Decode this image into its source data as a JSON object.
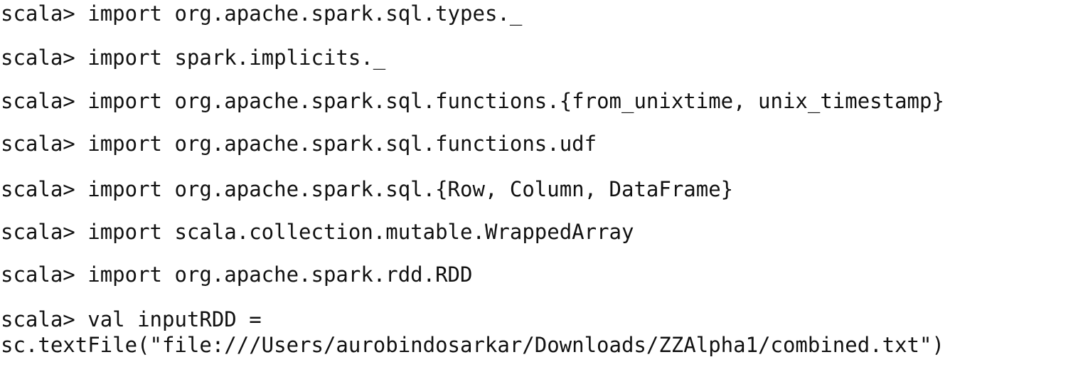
{
  "console": {
    "prompt": "scala>",
    "lines": [
      {
        "command": "import org.apache.spark.sql.types._"
      },
      {
        "command": "import spark.implicits._"
      },
      {
        "command": "import org.apache.spark.sql.functions.{from_unixtime, unix_timestamp}"
      },
      {
        "command": "import org.apache.spark.sql.functions.udf"
      },
      {
        "command": "import org.apache.spark.sql.{Row, Column, DataFrame}"
      },
      {
        "command": "import scala.collection.mutable.WrappedArray"
      },
      {
        "command": "import org.apache.spark.rdd.RDD"
      },
      {
        "command": "val inputRDD =",
        "continuation": "sc.textFile(\"file:///Users/aurobindosarkar/Downloads/ZZAlpha1/combined.txt\")"
      }
    ]
  }
}
